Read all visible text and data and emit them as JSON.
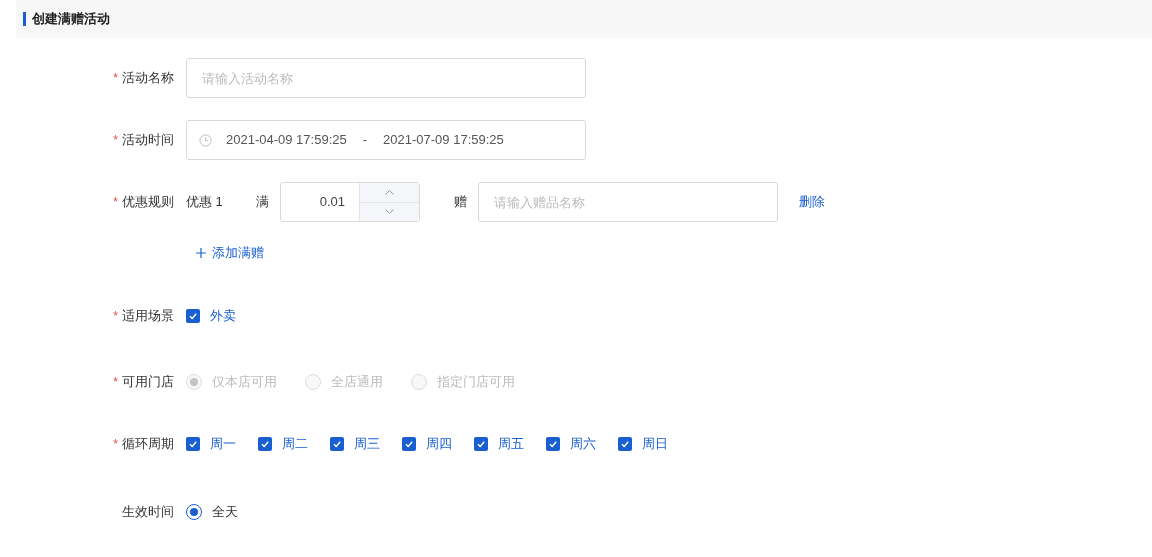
{
  "header": {
    "title": "创建满赠活动"
  },
  "name_field": {
    "label": "活动名称",
    "required_mark": "*",
    "placeholder": "请输入活动名称"
  },
  "time_field": {
    "label": "活动时间",
    "required_mark": "*",
    "start": "2021-04-09 17:59:25",
    "separator": "-",
    "end": "2021-07-09 17:59:25"
  },
  "rules": {
    "label": "优惠规则",
    "required_mark": "*",
    "items": [
      {
        "name": "优惠 1",
        "threshold_label": "满",
        "threshold": "0.01",
        "gift_label": "赠",
        "gift_placeholder": "请输入赠品名称",
        "delete": "删除"
      }
    ],
    "add": "添加满赠"
  },
  "scene": {
    "label": "适用场景",
    "required_mark": "*",
    "options": [
      {
        "label": "外卖",
        "checked": true
      }
    ]
  },
  "stores": {
    "label": "可用门店",
    "required_mark": "*",
    "options": [
      {
        "label": "仅本店可用",
        "selected": true,
        "disabled": true
      },
      {
        "label": "全店通用",
        "selected": false,
        "disabled": true
      },
      {
        "label": "指定门店可用",
        "selected": false,
        "disabled": true
      }
    ]
  },
  "cycle": {
    "label": "循环周期",
    "required_mark": "*",
    "options": [
      {
        "label": "周一",
        "checked": true
      },
      {
        "label": "周二",
        "checked": true
      },
      {
        "label": "周三",
        "checked": true
      },
      {
        "label": "周四",
        "checked": true
      },
      {
        "label": "周五",
        "checked": true
      },
      {
        "label": "周六",
        "checked": true
      },
      {
        "label": "周日",
        "checked": true
      }
    ]
  },
  "effective": {
    "label": "生效时间",
    "options": [
      {
        "label": "全天",
        "selected": true,
        "disabled": false
      }
    ]
  }
}
